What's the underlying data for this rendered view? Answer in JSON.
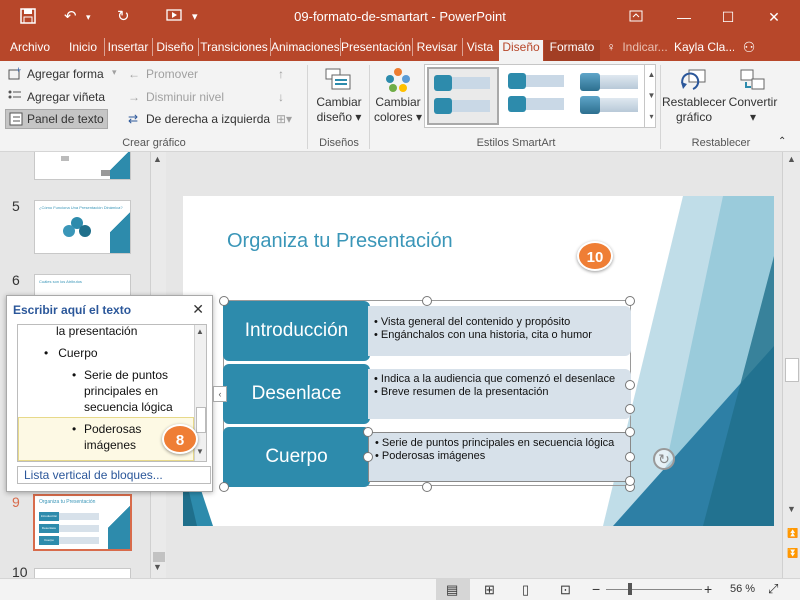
{
  "window": {
    "title": "09-formato-de-smartart - PowerPoint"
  },
  "tabs": [
    "Archivo",
    "Inicio",
    "Insertar",
    "Diseño",
    "Transiciones",
    "Animaciones",
    "Presentación",
    "Revisar",
    "Vista",
    "Diseño",
    "Formato"
  ],
  "tell_me": "Indicar...",
  "user": "Kayla Cla...",
  "ribbon": {
    "crear": {
      "agregar_forma": "Agregar forma",
      "agregar_vineta": "Agregar viñeta",
      "panel_texto": "Panel de texto",
      "promover": "Promover",
      "disminuir": "Disminuir nivel",
      "derecha_izquierda": "De derecha a izquierda",
      "label": "Crear gráfico"
    },
    "disenos": {
      "cambiar_line1": "Cambiar",
      "cambiar_line2": "diseño",
      "label": "Diseños"
    },
    "estilos": {
      "cambiar_colores_line1": "Cambiar",
      "cambiar_colores_line2": "colores",
      "label": "Estilos SmartArt"
    },
    "restablecer": {
      "restablecer_line1": "Restablecer",
      "restablecer_line2": "gráfico",
      "convertir": "Convertir",
      "label": "Restablecer"
    }
  },
  "thumbnails": {
    "slide_numbers": [
      "5",
      "6",
      "9",
      "10"
    ],
    "slide5_text": "¿Cómo Funciona Una Presentación Dinámica?",
    "slide6_text": "Cuáles son los Atributos",
    "slide9_title": "Organiza tu Presentación",
    "slide9_rows": [
      "Introducción",
      "Desenlace",
      "Cuerpo"
    ]
  },
  "text_pane": {
    "title": "Escribir aquí el texto",
    "items": [
      "la presentación",
      "Cuerpo",
      "Serie de puntos principales en secuencia lógica",
      "Poderosas imágenes"
    ],
    "footer": "Lista vertical de bloques..."
  },
  "slide": {
    "title": "Organiza tu Presentación",
    "rows": [
      {
        "label": "Introducción",
        "bullets": [
          "Vista general del contenido y propósito",
          "Engánchalos con una historia, cita o humor"
        ]
      },
      {
        "label": "Desenlace",
        "bullets": [
          "Indica a la audiencia que comenzó el desenlace",
          "Breve resumen de la presentación"
        ]
      },
      {
        "label": "Cuerpo",
        "bullets": [
          "Serie de puntos principales en secuencia lógica",
          "Poderosas imágenes"
        ]
      }
    ]
  },
  "badges": {
    "step8": "8",
    "step10": "10"
  },
  "status": {
    "zoom": "56 %"
  },
  "colors": {
    "accent": "#b7472a",
    "smartart": "#2d8bac",
    "detail": "#d7e1ea",
    "title": "#3a96b8",
    "badge": "#ef7e35"
  }
}
